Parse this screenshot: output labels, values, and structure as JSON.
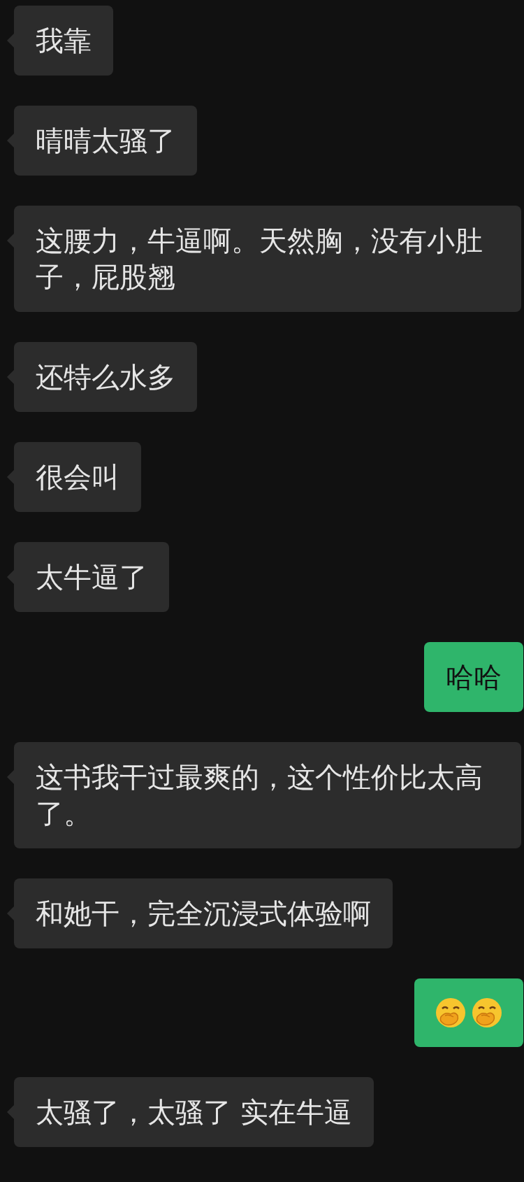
{
  "messages": [
    {
      "sent": false,
      "kind": "text",
      "text": "我靠"
    },
    {
      "sent": false,
      "kind": "text",
      "text": "晴晴太骚了"
    },
    {
      "sent": false,
      "kind": "text",
      "text": "这腰力，牛逼啊。天然胸，没有小肚子，屁股翘"
    },
    {
      "sent": false,
      "kind": "text",
      "text": "还特么水多"
    },
    {
      "sent": false,
      "kind": "text",
      "text": "很会叫"
    },
    {
      "sent": false,
      "kind": "text",
      "text": "太牛逼了"
    },
    {
      "sent": true,
      "kind": "text",
      "text": "哈哈"
    },
    {
      "sent": false,
      "kind": "text",
      "text": "这书我干过最爽的，这个性价比太高了。"
    },
    {
      "sent": false,
      "kind": "text",
      "text": "和她干，完全沉浸式体验啊"
    },
    {
      "sent": true,
      "kind": "emoji",
      "emojis": [
        {
          "kind": "hand-over-mouth"
        },
        {
          "kind": "hand-over-mouth"
        }
      ]
    },
    {
      "sent": false,
      "kind": "text",
      "text": "太骚了，太骚了 实在牛逼"
    }
  ]
}
